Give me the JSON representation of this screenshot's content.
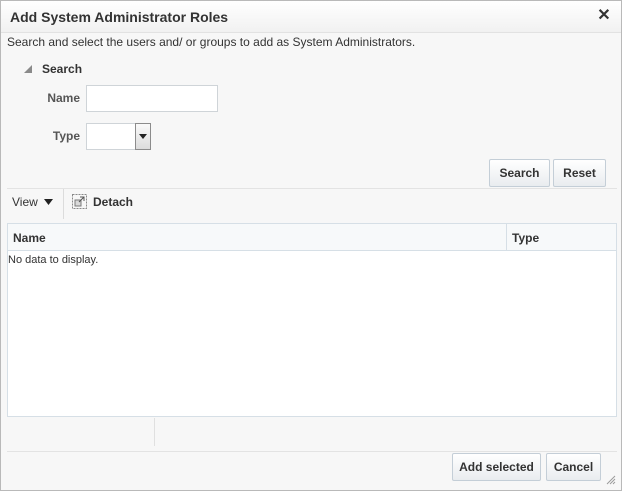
{
  "dialog": {
    "title": "Add System Administrator Roles",
    "close_symbol": "✕",
    "instructions": "Search and select the users and/ or groups to add as System Administrators."
  },
  "search": {
    "header": "Search",
    "name_label": "Name",
    "name_value": "",
    "type_label": "Type",
    "type_value": "",
    "search_button": "Search",
    "reset_button": "Reset"
  },
  "toolbar": {
    "view_label": "View",
    "detach_label": "Detach"
  },
  "table": {
    "columns": [
      "Name",
      "Type"
    ],
    "empty_text": "No data to display."
  },
  "footer": {
    "add_button": "Add selected",
    "cancel_button": "Cancel"
  },
  "icons": {
    "close": "close-icon",
    "disclosure": "disclosure-triangle-icon",
    "dropdown": "dropdown-arrow-icon",
    "view_menu": "view-menu-arrow-icon",
    "detach": "detach-icon",
    "resize": "resize-grip-icon"
  }
}
